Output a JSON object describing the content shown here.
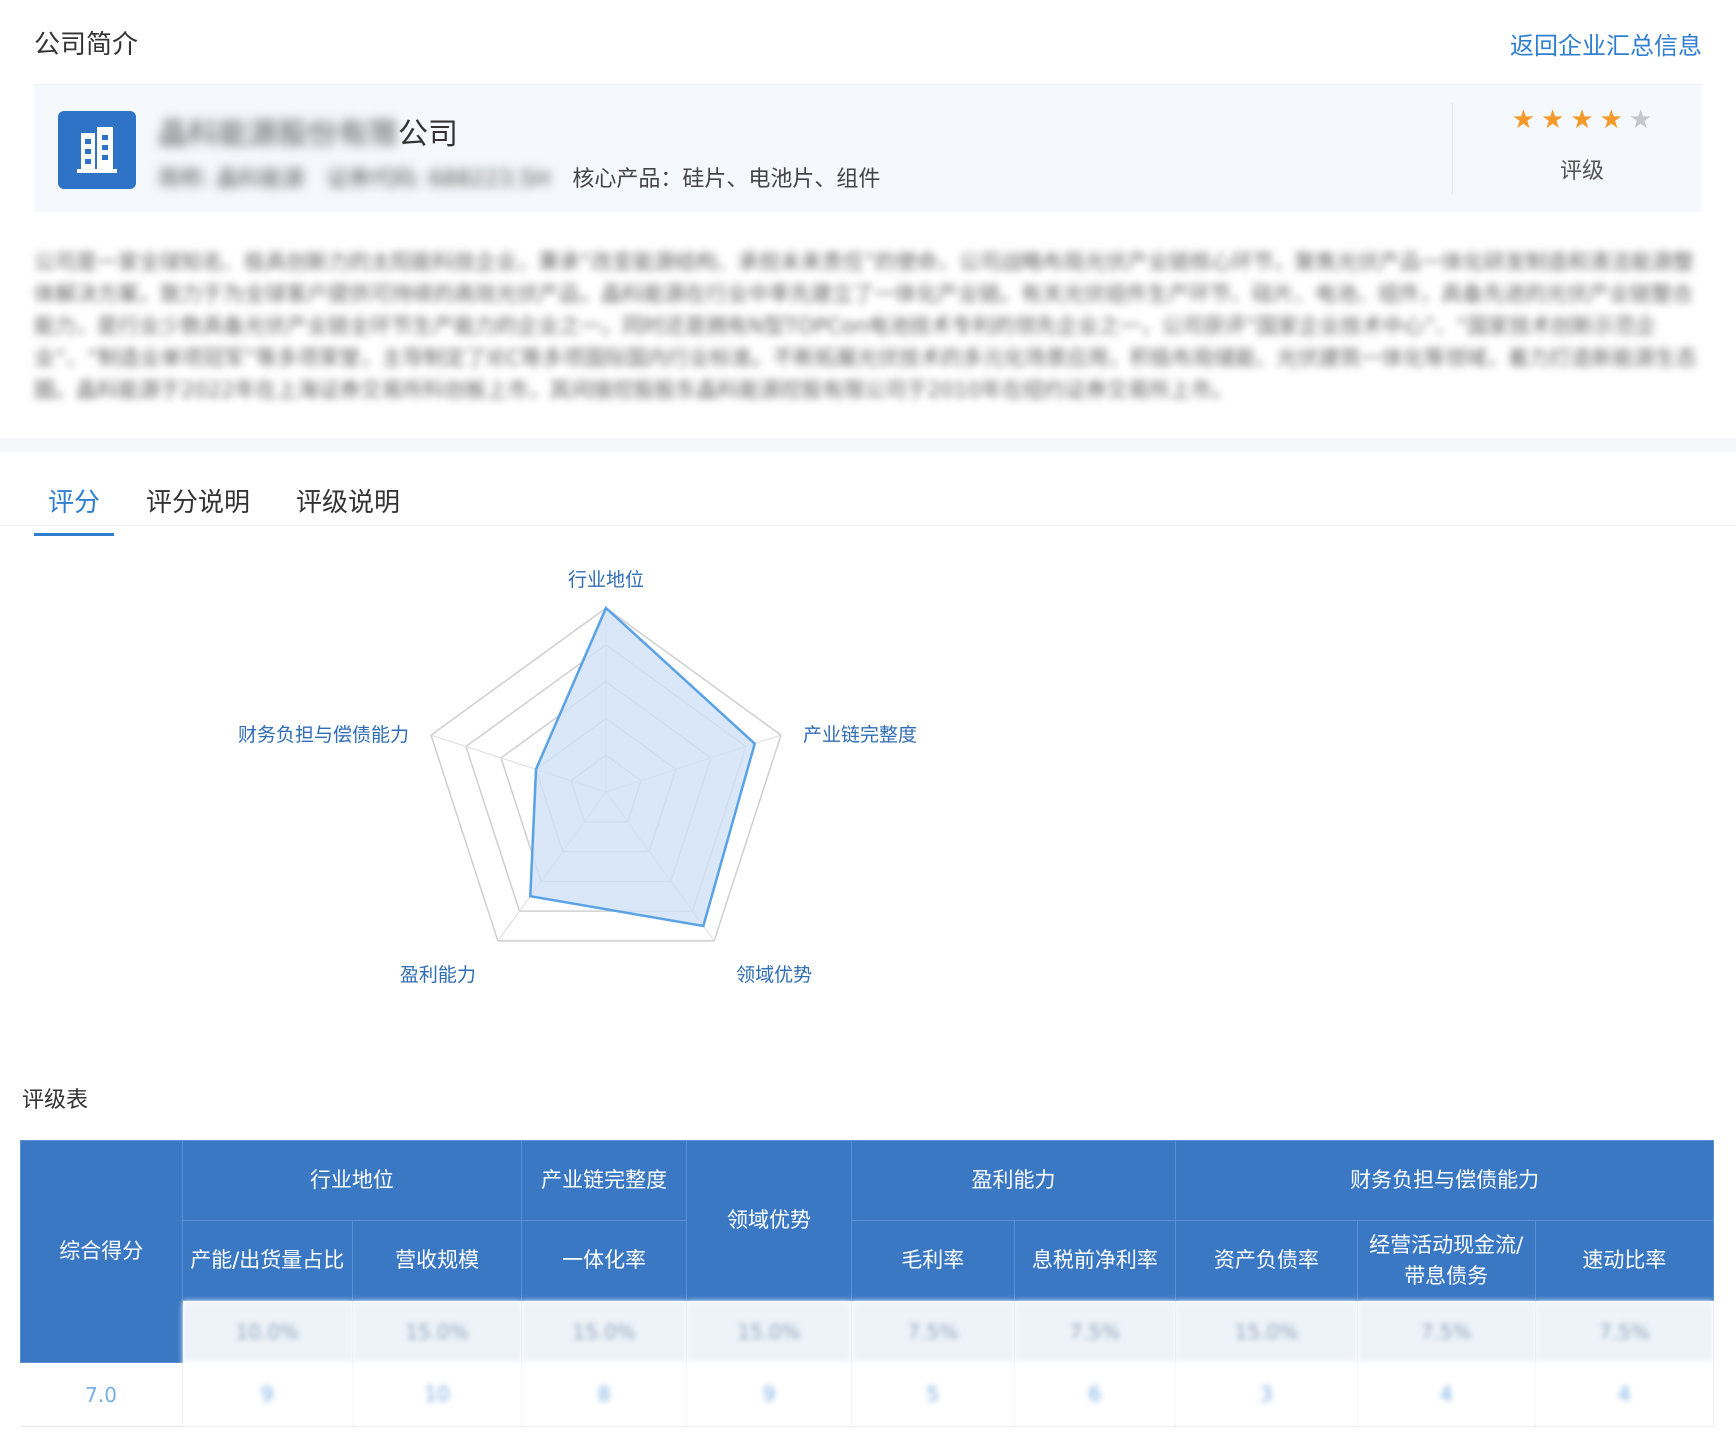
{
  "header": {
    "section_title": "公司简介",
    "back_link": "返回企业汇总信息"
  },
  "company": {
    "name_blurred": "晶科能源股份有限",
    "name_suffix": "公司",
    "short_name_label": "简称:",
    "short_name": "晶科能源",
    "stock_code_label": "证券代码:",
    "stock_code": "688223.SH",
    "core_products": "核心产品：硅片、电池片、组件",
    "rating_label": "评级",
    "stars_filled": 4,
    "stars_total": 5
  },
  "description": "公司是一家全球知名、极具创新力的太阳能科技企业，秉承“改变能源结构、承担未来责任”的使命，公司战略布局光伏产业链核心环节，聚焦光伏产品一体化研发制造和清洁能源整体解决方案，致力于为全球客户提供可持续的高效光伏产品，晶科能源在行业中率先建立了一体化产业链。有关光伏组件生产环节、硅片、电池、组件，具备先进的光伏产业链整合能力，是行业少数具备光伏产业链全环节生产能力的企业之一。同时还是拥有N型TOPCon电池技术专利的领先企业之一，公司获评“国家企业技术中心”、“国家技术创新示范企业”、“制造业单项冠军”等多项荣誉，主导制定了IEC等多项国际国内行业标准。不断拓展光伏技术的多元化场景应用，积极布局储能、光伏建筑一体化等领域，着力打造新能源生态圈。晶科能源于2022年在上海证券交易所科创板上市，其间接控股股东晶科能源控股有限公司于2010年在纽约证券交易所上市。",
  "tabs": [
    {
      "label": "评分",
      "active": true
    },
    {
      "label": "评分说明",
      "active": false
    },
    {
      "label": "评级说明",
      "active": false
    }
  ],
  "chart_data": {
    "type": "radar",
    "axes": [
      "行业地位",
      "产业链完整度",
      "领域优势",
      "盈利能力",
      "财务负担与偿债能力"
    ],
    "max": 10,
    "rings": 5,
    "series": [
      {
        "values": [
          10,
          8.5,
          9,
          7,
          4
        ],
        "color": "#5aa2e6",
        "fill": "#cfe1f6"
      }
    ]
  },
  "table": {
    "title": "评级表",
    "total_header": "综合得分",
    "groups": [
      {
        "label": "行业地位",
        "span": 2
      },
      {
        "label": "产业链完整度",
        "span": 1
      },
      {
        "label": "领域优势",
        "span": 1,
        "rowspan": 2
      },
      {
        "label": "盈利能力",
        "span": 2
      },
      {
        "label": "财务负担与偿债能力",
        "span": 3
      }
    ],
    "sub_headers": [
      "产能/出货量占比",
      "营收规模",
      "一体化率",
      "毛利率",
      "息税前净利率",
      "资产负债率",
      "经营活动现金流/带息债务",
      "速动比率"
    ],
    "weights": [
      "10.0%",
      "15.0%",
      "15.0%",
      "15.0%",
      "7.5%",
      "7.5%",
      "15.0%",
      "7.5%",
      "7.5%"
    ],
    "total_score": "7.0",
    "scores": [
      "9",
      "10",
      "8",
      "9",
      "5",
      "6",
      "3",
      "4",
      "4"
    ]
  },
  "colors": {
    "accent": "#2f7fd1",
    "header_bg": "#3a78c4",
    "star_on": "#f39a2b",
    "star_off": "#c4c7cc"
  }
}
